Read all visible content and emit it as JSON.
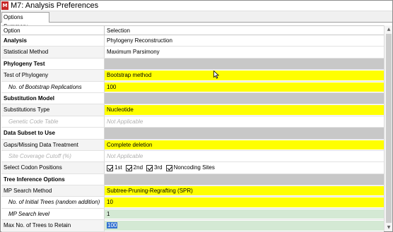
{
  "window": {
    "app_icon": "M",
    "title": "M7: Analysis Preferences"
  },
  "tabs": [
    {
      "label": "Options Summary"
    }
  ],
  "columns": {
    "option": "Option",
    "selection": "Selection"
  },
  "rows": [
    {
      "option": "Analysis",
      "selection": "Phylogeny Reconstruction"
    },
    {
      "option": "Statistical Method",
      "selection": "Maximum Parsimony"
    },
    {
      "option": "Phylogeny Test",
      "selection": ""
    },
    {
      "option": "Test of Phylogeny",
      "selection": "Bootstrap method"
    },
    {
      "option": "No. of Bootstrap Replications",
      "selection": "100"
    },
    {
      "option": "Substitution Model",
      "selection": ""
    },
    {
      "option": "Substitutions Type",
      "selection": "Nucleotide"
    },
    {
      "option": "Genetic Code Table",
      "selection": "Not Applicable"
    },
    {
      "option": "Data Subset to Use",
      "selection": ""
    },
    {
      "option": "Gaps/Missing Data Treatment",
      "selection": "Complete deletion"
    },
    {
      "option": "Site Coverage Cutoff (%)",
      "selection": "Not Applicable"
    },
    {
      "option": "Select Codon Positions",
      "selection": ""
    },
    {
      "option": "Tree Inference Options",
      "selection": ""
    },
    {
      "option": "MP Search Method",
      "selection": "Subtree-Pruning-Regrafting (SPR)"
    },
    {
      "option": "No. of Initial Trees (random addition)",
      "selection": "10"
    },
    {
      "option": "MP Search level",
      "selection": "1"
    },
    {
      "option": "Max No. of Trees to Retain",
      "selection": "100"
    }
  ],
  "codon_positions": [
    {
      "label": "1st",
      "checked": true
    },
    {
      "label": "2nd",
      "checked": true
    },
    {
      "label": "3rd",
      "checked": true
    },
    {
      "label": "Noncoding Sites",
      "checked": true
    }
  ],
  "colors": {
    "highlight_yellow": "#ffff00",
    "highlight_green": "#d4e9d4",
    "section_gray": "#c8c8c8",
    "selection_blue": "#3070d0"
  },
  "icons": {
    "scroll_up": "▲",
    "scroll_down": "▼"
  }
}
